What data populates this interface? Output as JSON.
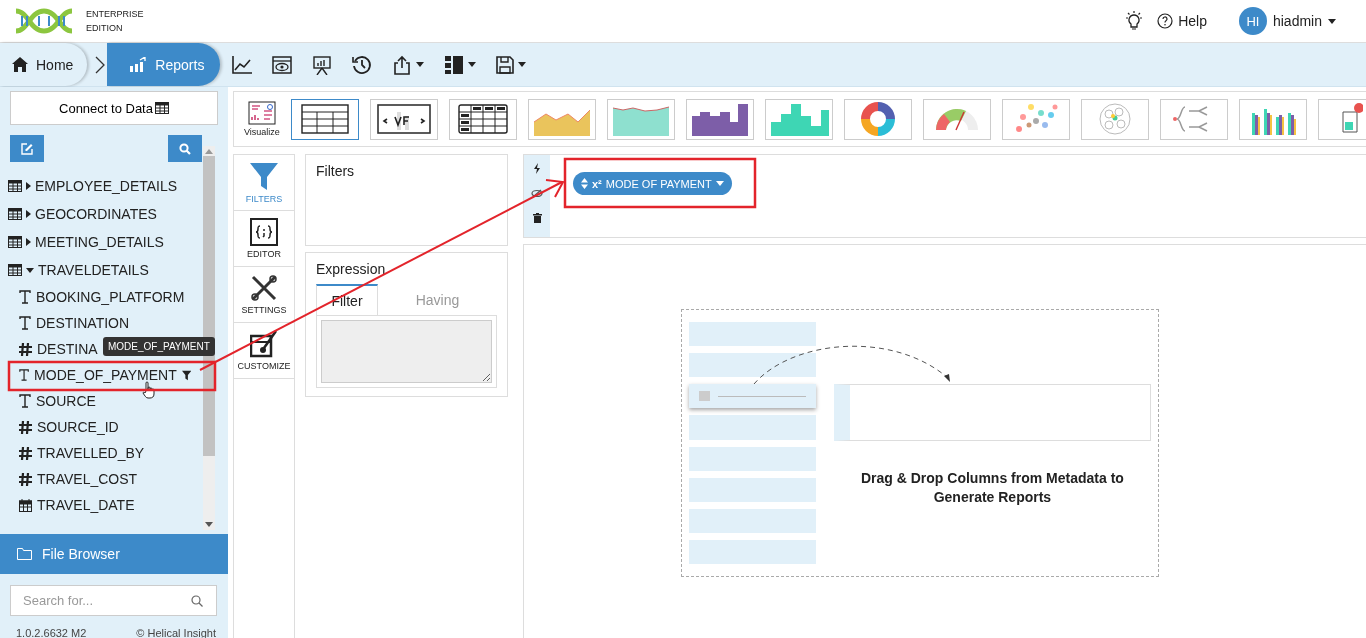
{
  "header": {
    "logo_line1": "ENTERPRISE",
    "logo_line2": "EDITION",
    "help": "Help",
    "user_initials": "HI",
    "user_name": "hiadmin"
  },
  "breadcrumb": [
    {
      "label": "Home",
      "kind": "home",
      "selected": false
    },
    {
      "label": "Reports",
      "kind": "reports",
      "selected": true
    }
  ],
  "toolbar": [
    {
      "kind": "line-chart",
      "caret": false
    },
    {
      "kind": "preview",
      "caret": false
    },
    {
      "kind": "presentation",
      "caret": false
    },
    {
      "kind": "history",
      "caret": false
    },
    {
      "kind": "share",
      "caret": true
    },
    {
      "kind": "layout",
      "caret": true
    },
    {
      "kind": "save",
      "caret": true
    }
  ],
  "left_panel": {
    "connect_button": "Connect to Data",
    "tree": [
      {
        "label": "EMPLOYEE_DETAILS",
        "expanded": false
      },
      {
        "label": "GEOCORDINATES",
        "expanded": false
      },
      {
        "label": "MEETING_DETAILS",
        "expanded": false
      },
      {
        "label": "TRAVELDETAILS",
        "expanded": true,
        "children": [
          {
            "label": "BOOKING_PLATFORM",
            "kind": "text",
            "filter": false
          },
          {
            "label": "DESTINATION",
            "kind": "text",
            "filter": false
          },
          {
            "label": "DESTINA",
            "kind": "number",
            "filter": false
          },
          {
            "label": "MODE_OF_PAYMENT",
            "kind": "text",
            "filter": true
          },
          {
            "label": "SOURCE",
            "kind": "text",
            "filter": false
          },
          {
            "label": "SOURCE_ID",
            "kind": "number",
            "filter": false
          },
          {
            "label": "TRAVELLED_BY",
            "kind": "number",
            "filter": false
          },
          {
            "label": "TRAVEL_COST",
            "kind": "number",
            "filter": false
          },
          {
            "label": "TRAVEL_DATE",
            "kind": "date",
            "filter": false
          }
        ]
      }
    ],
    "tooltip": "MODE_OF_PAYMENT",
    "file_browser": "File Browser",
    "search": {
      "placeholder": "Search for..."
    },
    "version": "1.0.2.6632 M2",
    "copyright": "© Helical Insight"
  },
  "visualize": {
    "label": "Visualize",
    "types": [
      {
        "kind": "table",
        "selected": true
      },
      {
        "kind": "vf",
        "selected": false
      },
      {
        "kind": "crosstab",
        "selected": false
      },
      {
        "kind": "area",
        "selected": false
      },
      {
        "kind": "area2",
        "selected": false
      },
      {
        "kind": "step",
        "selected": false
      },
      {
        "kind": "histogram",
        "selected": false
      },
      {
        "kind": "donut",
        "selected": false
      },
      {
        "kind": "gauge",
        "selected": false
      },
      {
        "kind": "scatter",
        "selected": false
      },
      {
        "kind": "pack",
        "selected": false
      },
      {
        "kind": "tree",
        "selected": false
      },
      {
        "kind": "bars",
        "selected": false
      },
      {
        "kind": "map",
        "selected": false
      }
    ]
  },
  "side_tabs": [
    {
      "label": "FILTERS",
      "kind": "filters",
      "selected": true
    },
    {
      "label": "EDITOR",
      "kind": "editor",
      "selected": false
    },
    {
      "label": "SETTINGS",
      "kind": "settings",
      "selected": false
    },
    {
      "label": "CUSTOMIZE",
      "kind": "customize",
      "selected": false
    }
  ],
  "filters_panel": {
    "title": "Filters"
  },
  "expression": {
    "title": "Expression",
    "tabs": [
      {
        "label": "Filter",
        "selected": true
      },
      {
        "label": "Having",
        "selected": false
      }
    ]
  },
  "canvas": {
    "pill": {
      "prefix": "x²",
      "label": "MODE OF PAYMENT"
    },
    "hint": "Drag & Drop Columns from Metadata to Generate Reports"
  }
}
